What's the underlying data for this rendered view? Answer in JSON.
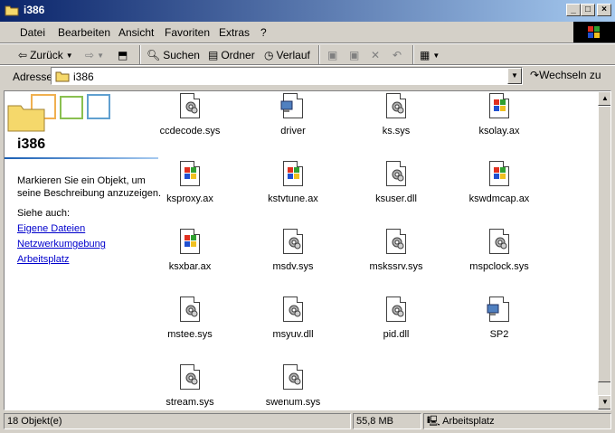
{
  "window": {
    "title": "i386"
  },
  "menu": [
    "Datei",
    "Bearbeiten",
    "Ansicht",
    "Favoriten",
    "Extras",
    "?"
  ],
  "toolbar": {
    "back": "Zurück",
    "search": "Suchen",
    "folders": "Ordner",
    "history": "Verlauf"
  },
  "address": {
    "label": "Adresse",
    "value": "i386",
    "go": "Wechseln zu"
  },
  "left_pane": {
    "folder_name": "i386",
    "description": "Markieren Sie ein Objekt, um seine Beschreibung anzuzeigen.",
    "see_also": "Siehe auch:",
    "links": [
      "Eigene Dateien",
      "Netzwerkumgebung",
      "Arbeitsplatz"
    ]
  },
  "files": [
    {
      "name": "ccdecode.sys",
      "icon": "gear-file-icon"
    },
    {
      "name": "driver",
      "icon": "setup-icon"
    },
    {
      "name": "ks.sys",
      "icon": "gear-file-icon"
    },
    {
      "name": "ksolay.ax",
      "icon": "windows-file-icon"
    },
    {
      "name": "ksproxy.ax",
      "icon": "windows-file-icon"
    },
    {
      "name": "kstvtune.ax",
      "icon": "windows-file-icon"
    },
    {
      "name": "ksuser.dll",
      "icon": "gear-file-icon"
    },
    {
      "name": "kswdmcap.ax",
      "icon": "windows-file-icon"
    },
    {
      "name": "ksxbar.ax",
      "icon": "windows-file-icon"
    },
    {
      "name": "msdv.sys",
      "icon": "gear-file-icon"
    },
    {
      "name": "mskssrv.sys",
      "icon": "gear-file-icon"
    },
    {
      "name": "mspclock.sys",
      "icon": "gear-file-icon"
    },
    {
      "name": "mstee.sys",
      "icon": "gear-file-icon"
    },
    {
      "name": "msyuv.dll",
      "icon": "gear-file-icon"
    },
    {
      "name": "pid.dll",
      "icon": "gear-file-icon"
    },
    {
      "name": "SP2",
      "icon": "setup-icon"
    },
    {
      "name": "stream.sys",
      "icon": "gear-file-icon"
    },
    {
      "name": "swenum.sys",
      "icon": "gear-file-icon"
    }
  ],
  "status": {
    "count": "18 Objekt(e)",
    "size": "55,8 MB",
    "zone": "Arbeitsplatz"
  }
}
